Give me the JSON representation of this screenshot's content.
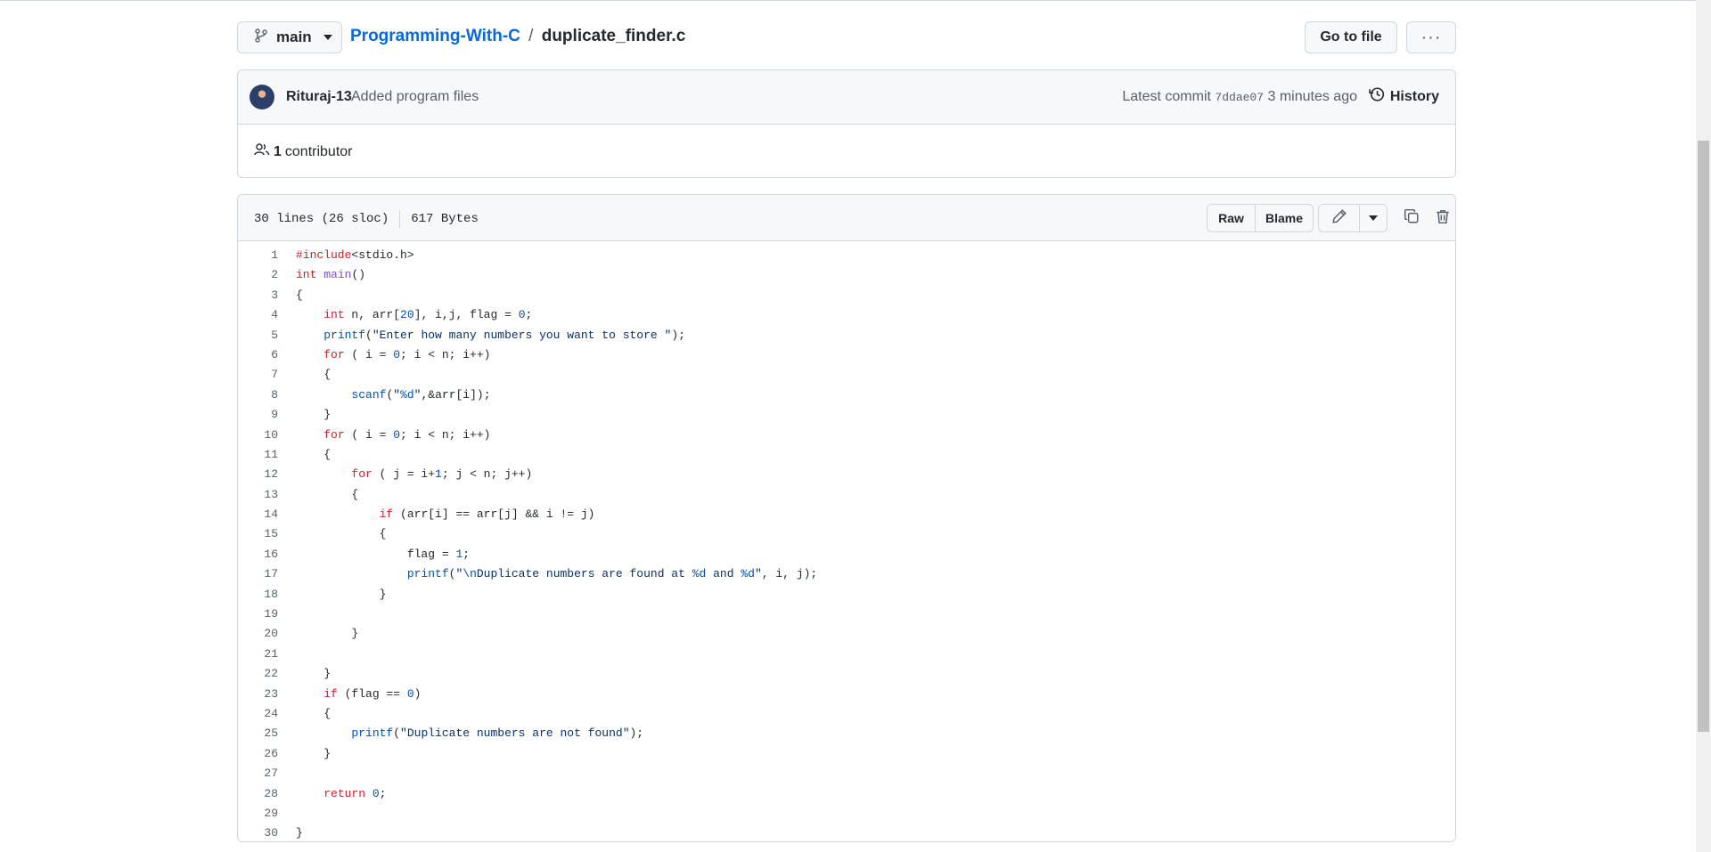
{
  "branch": {
    "name": "main"
  },
  "breadcrumb": {
    "repo": "Programming-With-C",
    "separator": "/",
    "file": "duplicate_finder.c"
  },
  "actions": {
    "goto_file": "Go to file",
    "more": "···"
  },
  "commit": {
    "author": "Rituraj-13",
    "message": "Added program files",
    "latest_label": "Latest commit",
    "sha": "7ddae07",
    "time": "3 minutes ago",
    "history": "History"
  },
  "contributors": {
    "count": "1",
    "label": "contributor"
  },
  "file": {
    "lines_info": "30 lines (26 sloc)",
    "size": "617 Bytes",
    "raw": "Raw",
    "blame": "Blame"
  },
  "code_lines": [
    "#include<stdio.h>",
    "int main()",
    "{",
    "    int n, arr[20], i,j, flag = 0;",
    "    printf(\"Enter how many numbers you want to store \");",
    "    for ( i = 0; i < n; i++)",
    "    {",
    "        scanf(\"%d\",&arr[i]);",
    "    }",
    "    for ( i = 0; i < n; i++)",
    "    {",
    "        for ( j = i+1; j < n; j++)",
    "        {",
    "            if (arr[i] == arr[j] && i != j)",
    "            {",
    "                flag = 1;",
    "                printf(\"\\nDuplicate numbers are found at %d and %d\", i, j);",
    "            }",
    "",
    "        }",
    "",
    "    }",
    "    if (flag == 0)",
    "    {",
    "        printf(\"Duplicate numbers are not found\");",
    "    }",
    "",
    "    return 0;",
    "",
    "}"
  ],
  "icons": [
    "branch-icon",
    "history-icon",
    "people-icon",
    "pencil-icon",
    "copy-icon",
    "trash-icon"
  ],
  "colors": {
    "link": "#0969da",
    "keyword": "#cf222e",
    "function": "#8250df",
    "constant": "#0550ae",
    "string": "#0a3069"
  }
}
